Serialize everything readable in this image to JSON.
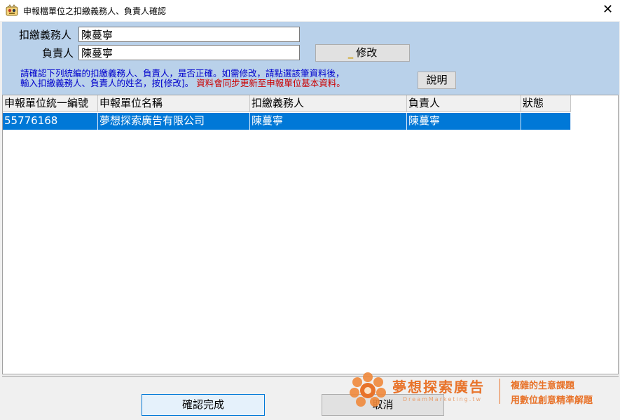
{
  "window": {
    "title": "申報檔單位之扣繳義務人、負責人確認",
    "close_glyph": "✕"
  },
  "form": {
    "withholder_label": "扣繳義務人",
    "withholder_value": "陳蔓寧",
    "responsible_label": "負責人",
    "responsible_value": "陳蔓寧",
    "edit_button_dash": "_",
    "edit_button_label": "修改",
    "instructions_line1": "請確認下列統編的扣繳義務人、負責人，是否正確。如需修改，請點選該筆資料後，",
    "instructions_line2_blue": "輸入扣繳義務人、負責人的姓名，按[修改]。",
    "instructions_line2_red": "資料會同步更新至申報單位基本資料。",
    "help_button_label": "說明"
  },
  "grid": {
    "columns": [
      "申報單位統一編號",
      "申報單位名稱",
      "扣繳義務人",
      "負責人",
      "狀態"
    ],
    "rows": [
      [
        "55776168",
        "夢想探索廣告有限公司",
        "陳蔓寧",
        "陳蔓寧",
        ""
      ]
    ]
  },
  "footer": {
    "confirm_label": "確認完成",
    "cancel_label": "取消"
  },
  "watermark": {
    "name": "夢想探索廣告",
    "url": "DreamMarketing.tw",
    "tagline1": "複雜的生意課題",
    "tagline2": "用數位創意精準解題"
  },
  "colors": {
    "panel": "#b9d1ea",
    "selection": "#0078d7",
    "instruction_blue": "#0000cc",
    "instruction_red": "#cc0000",
    "brand_orange": "#e8732a"
  }
}
